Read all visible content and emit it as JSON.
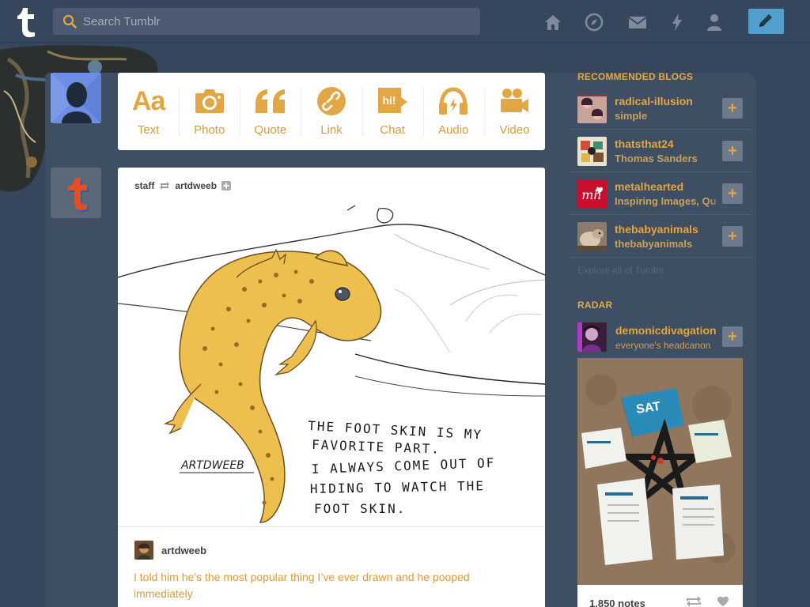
{
  "header": {
    "search_placeholder": "Search Tumblr",
    "nav_icons": [
      "home-icon",
      "explore-icon",
      "inbox-icon",
      "activity-icon",
      "account-icon"
    ],
    "compose_icon": "pencil-icon"
  },
  "colors": {
    "background": "#36465d",
    "accent": "#e2a744",
    "compose": "#529ecc"
  },
  "post_types": [
    {
      "label": "Text",
      "icon": "text-icon"
    },
    {
      "label": "Photo",
      "icon": "camera-icon"
    },
    {
      "label": "Quote",
      "icon": "quote-icon"
    },
    {
      "label": "Link",
      "icon": "link-icon"
    },
    {
      "label": "Chat",
      "icon": "chat-icon"
    },
    {
      "label": "Audio",
      "icon": "headphones-icon"
    },
    {
      "label": "Video",
      "icon": "video-camera-icon"
    }
  ],
  "post": {
    "reblogger": "staff",
    "source": "artdweeb",
    "caption_author": "artdweeb",
    "caption": "I told him he’s the most popular thing I’ve ever drawn and he pooped immediately",
    "image_text": {
      "signature": "ARTDWEEB",
      "line1": "THE FOOT SKIN IS MY",
      "line2": "FAVORITE PART.",
      "line3": "I ALWAYS COME OUT OF",
      "line4": "HIDING TO WATCH THE",
      "line5": "FOOT SKIN."
    }
  },
  "sidebar": {
    "recommended_title": "RECOMMENDED BLOGS",
    "recommended": [
      {
        "name": "radical-illusion",
        "subtitle": "simple"
      },
      {
        "name": "thatsthat24",
        "subtitle": "Thomas Sanders"
      },
      {
        "name": "metalhearted",
        "subtitle": "Inspiring Images, Qu"
      },
      {
        "name": "thebabyanimals",
        "subtitle": "thebabyanimals"
      }
    ],
    "explore": "Explore all of Tumblr",
    "radar_title": "RADAR",
    "radar": {
      "name": "demonicdivagation",
      "subtitle": "everyone's headcanon",
      "notes": "1,850 notes",
      "photo_text": "SAT"
    },
    "follow_symbol": "+"
  }
}
